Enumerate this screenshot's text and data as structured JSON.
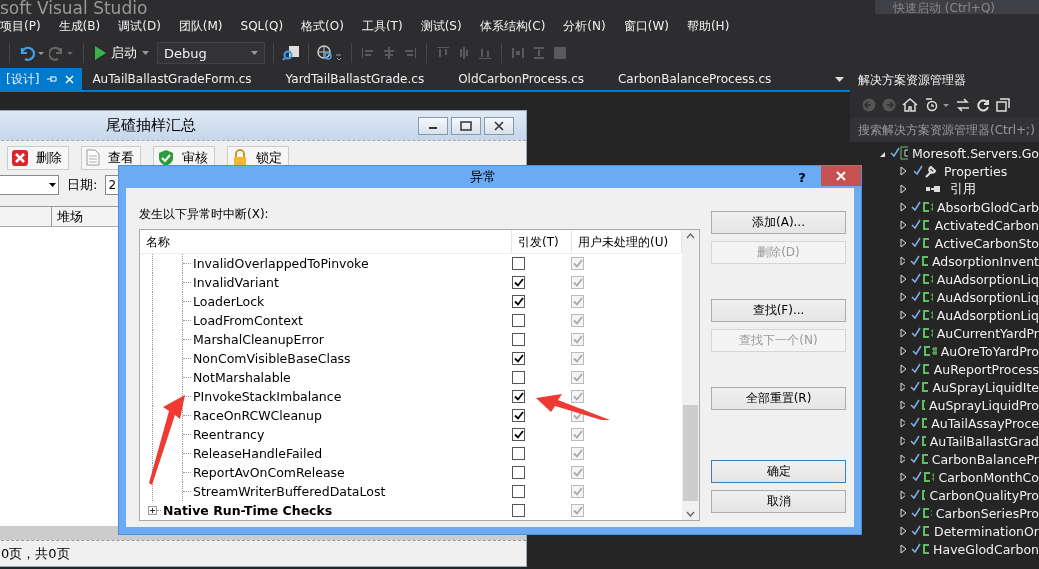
{
  "vs_window": {
    "title": "soft Visual Studio",
    "quick_launch": {
      "placeholder": "快速启动 (Ctrl+Q)"
    }
  },
  "menu": [
    "项目(P)",
    "生成(B)",
    "调试(D)",
    "团队(M)",
    "SQL(Q)",
    "格式(O)",
    "工具(T)",
    "测试(S)",
    "体系结构(C)",
    "分析(N)",
    "窗口(W)",
    "帮助(H)"
  ],
  "toolbar": {
    "start_label": "启动",
    "configuration": "Debug"
  },
  "document_tabs": [
    {
      "label": "[设计]",
      "selected": true
    },
    {
      "label": "AuTailBallastGradeForm.cs",
      "selected": false
    },
    {
      "label": "YardTailBallastGrade.cs",
      "selected": false
    },
    {
      "label": "OldCarbonProcess.cs",
      "selected": false
    },
    {
      "label": "CarbonBalanceProcess.cs",
      "selected": false
    }
  ],
  "designer_form": {
    "title": "尾碴抽样汇总",
    "toolbar": [
      {
        "label": "删除",
        "kind": "delete"
      },
      {
        "label": "查看",
        "kind": "view"
      },
      {
        "label": "审核",
        "kind": "approve"
      },
      {
        "label": "锁定",
        "kind": "lock"
      }
    ],
    "date_label": "日期:",
    "date_value": "2",
    "grid_columns": [
      "堆场"
    ],
    "pager": "0页，共0页"
  },
  "dialog": {
    "title": "异常",
    "help": "?",
    "prompt": "发生以下异常时中断(X):",
    "columns": [
      "名称",
      "引发(T)",
      "用户未处理的(U)"
    ],
    "rows": [
      {
        "name": "InvalidOverlappedToPinvoke",
        "thrown": false,
        "user_unhandled": true
      },
      {
        "name": "InvalidVariant",
        "thrown": true,
        "user_unhandled": true
      },
      {
        "name": "LoaderLock",
        "thrown": true,
        "user_unhandled": true
      },
      {
        "name": "LoadFromContext",
        "thrown": false,
        "user_unhandled": true
      },
      {
        "name": "MarshalCleanupError",
        "thrown": false,
        "user_unhandled": true
      },
      {
        "name": "NonComVisibleBaseClass",
        "thrown": true,
        "user_unhandled": true
      },
      {
        "name": "NotMarshalable",
        "thrown": false,
        "user_unhandled": true
      },
      {
        "name": "PInvokeStackImbalance",
        "thrown": true,
        "user_unhandled": true
      },
      {
        "name": "RaceOnRCWCleanup",
        "thrown": true,
        "user_unhandled": true
      },
      {
        "name": "Reentrancy",
        "thrown": true,
        "user_unhandled": true
      },
      {
        "name": "ReleaseHandleFailed",
        "thrown": false,
        "user_unhandled": true
      },
      {
        "name": "ReportAvOnComRelease",
        "thrown": false,
        "user_unhandled": true
      },
      {
        "name": "StreamWriterBufferedDataLost",
        "thrown": false,
        "user_unhandled": true
      }
    ],
    "group_row": {
      "name": "Native Run-Time Checks",
      "expanded": false,
      "thrown": false,
      "user_unhandled": true
    },
    "button_groups": [
      [
        {
          "label": "添加(A)...",
          "disabled": false,
          "default": false
        },
        {
          "label": "删除(D)",
          "disabled": true,
          "default": false
        }
      ],
      [
        {
          "label": "查找(F)...",
          "disabled": false,
          "default": false
        },
        {
          "label": "查找下一个(N)",
          "disabled": true,
          "default": false
        }
      ],
      [
        {
          "label": "全部重置(R)",
          "disabled": false,
          "default": false
        }
      ],
      [
        {
          "label": "确定",
          "disabled": false,
          "default": true
        },
        {
          "label": "取消",
          "disabled": false,
          "default": false
        }
      ]
    ]
  },
  "solution_explorer": {
    "title": "解决方案资源管理器",
    "search": {
      "placeholder": "搜索解决方案资源管理器(Ctrl+;)"
    },
    "tree": [
      {
        "label": "Moresoft.Servers.Go",
        "kind": "project",
        "expanded": true,
        "children": [
          {
            "label": "Properties",
            "kind": "properties",
            "expanded": false
          },
          {
            "label": "引用",
            "kind": "references",
            "expanded": false
          },
          {
            "label": "AbsorbGlodCarb",
            "kind": "csharp",
            "expanded": false
          },
          {
            "label": "ActivatedCarbon",
            "kind": "csharp",
            "expanded": false
          },
          {
            "label": "ActiveCarbonSto",
            "kind": "csharp",
            "expanded": false
          },
          {
            "label": "AdsorptionInvent",
            "kind": "csharp",
            "expanded": false
          },
          {
            "label": "AuAdsorptionLiq",
            "kind": "csharp",
            "expanded": false
          },
          {
            "label": "AuAdsorptionLiq",
            "kind": "csharp",
            "expanded": false
          },
          {
            "label": "AuAdsorptionLiq",
            "kind": "csharp",
            "expanded": false
          },
          {
            "label": "AuCurrentYardPr",
            "kind": "csharp",
            "expanded": false
          },
          {
            "label": "AuOreToYardPro",
            "kind": "csharp",
            "expanded": false
          },
          {
            "label": "AuReportProcess",
            "kind": "csharp",
            "expanded": false
          },
          {
            "label": "AuSprayLiquidIte",
            "kind": "csharp",
            "expanded": false
          },
          {
            "label": "AuSprayLiquidPro",
            "kind": "csharp",
            "expanded": false
          },
          {
            "label": "AuTailAssayProce",
            "kind": "csharp",
            "expanded": false
          },
          {
            "label": "AuTailBallastGrad",
            "kind": "csharp",
            "expanded": false
          },
          {
            "label": "CarbonBalancePr",
            "kind": "csharp",
            "expanded": false
          },
          {
            "label": "CarbonMonthCo",
            "kind": "csharp",
            "expanded": false
          },
          {
            "label": "CarbonQualityPro",
            "kind": "csharp",
            "expanded": false
          },
          {
            "label": "CarbonSeriesPro",
            "kind": "csharp",
            "expanded": false
          },
          {
            "label": "DeterminationOr",
            "kind": "csharp",
            "expanded": false
          },
          {
            "label": "HaveGlodCarbon",
            "kind": "csharp",
            "expanded": false
          }
        ]
      }
    ]
  }
}
